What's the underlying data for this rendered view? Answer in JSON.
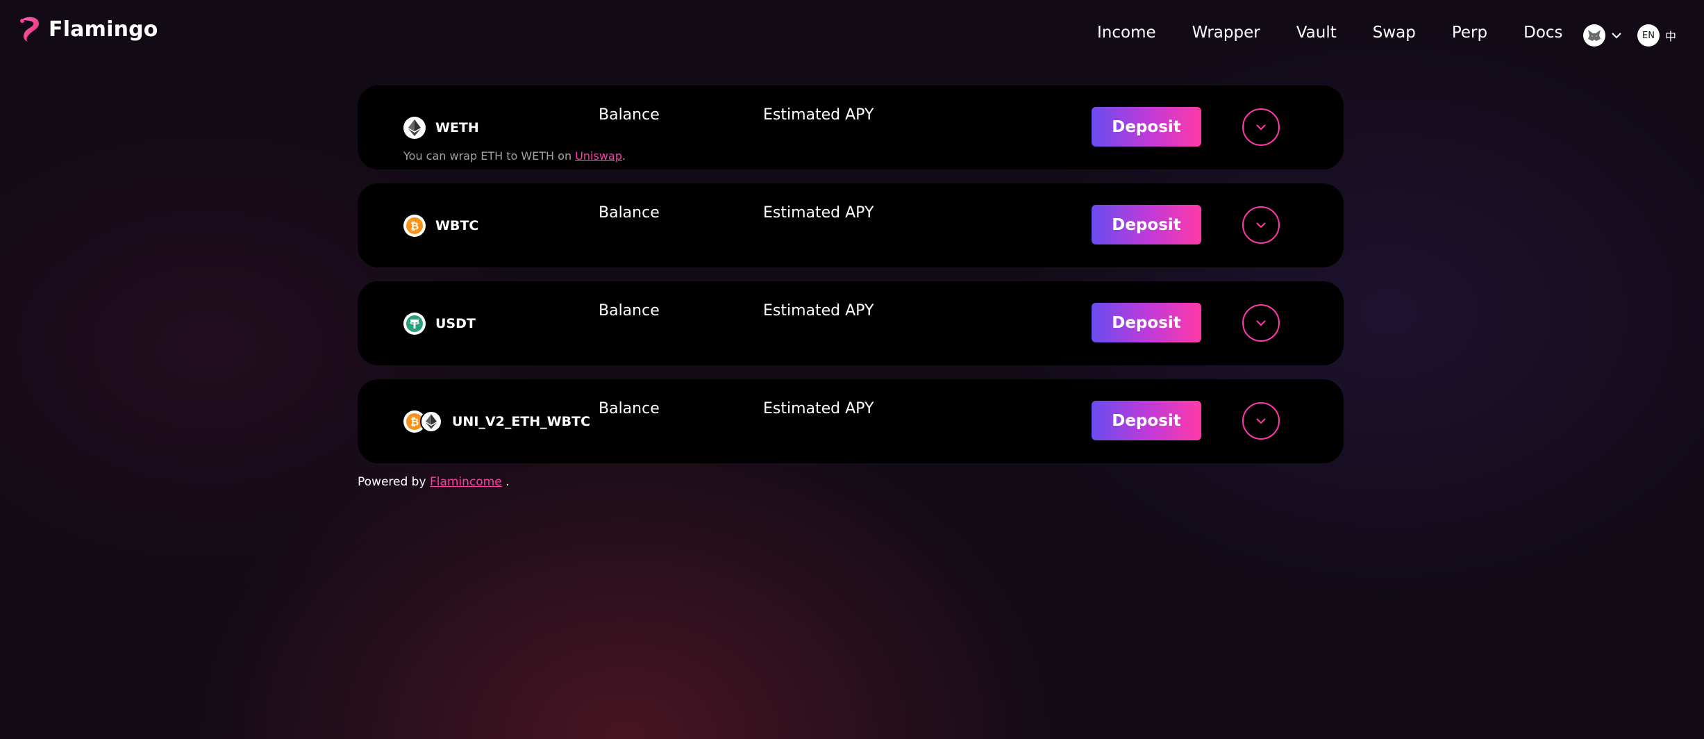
{
  "brand": {
    "name": "Flamingo",
    "accent": "#ff3aa8",
    "gradient_start": "#6a4cf0"
  },
  "nav": {
    "items": [
      {
        "label": "Income"
      },
      {
        "label": "Wrapper"
      },
      {
        "label": "Vault"
      },
      {
        "label": "Swap"
      },
      {
        "label": "Perp"
      },
      {
        "label": "Docs"
      }
    ]
  },
  "wallet": {
    "icon": "fox-icon"
  },
  "language": {
    "current": "EN",
    "alt": "中"
  },
  "columns": {
    "balance": "Balance",
    "apy": "Estimated APY"
  },
  "vaults": [
    {
      "token": "WETH",
      "icons": [
        "eth-icon"
      ],
      "deposit_label": "Deposit",
      "hint": {
        "prefix": "You can wrap ETH to WETH on ",
        "link": "Uniswap",
        "suffix": "."
      }
    },
    {
      "token": "WBTC",
      "icons": [
        "btc-icon"
      ],
      "deposit_label": "Deposit"
    },
    {
      "token": "USDT",
      "icons": [
        "tether-icon"
      ],
      "deposit_label": "Deposit"
    },
    {
      "token": "UNI_V2_ETH_WBTC",
      "icons": [
        "btc-icon",
        "eth-icon"
      ],
      "deposit_label": "Deposit"
    }
  ],
  "footer": {
    "prefix": "Powered by ",
    "link": "Flamincome",
    "suffix": " ."
  }
}
